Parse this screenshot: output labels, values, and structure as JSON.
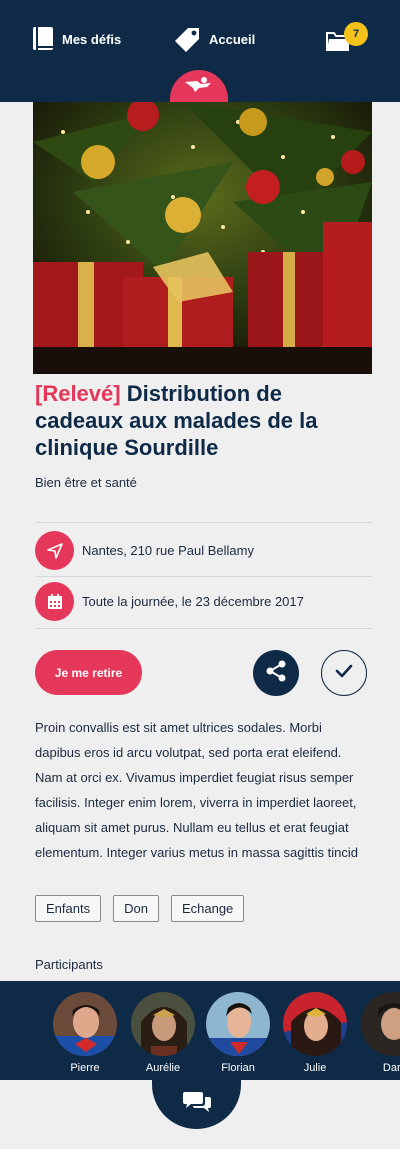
{
  "nav": {
    "defis_label": "Mes défis",
    "accueil_label": "Accueil",
    "folder_badge": "7"
  },
  "event": {
    "tag": "[Relevé]",
    "title": "Distribution de cadeaux aux malades de la clinique Sourdille",
    "category": "Bien être et santé",
    "location": "Nantes, 210 rue Paul Bellamy",
    "datetime": "Toute la journée, le 23 décembre 2017",
    "withdraw_label": "Je me retire",
    "description": "Proin convallis est sit amet ultrices sodales. Morbi dapibus eros id arcu volutpat, sed porta erat eleifend. Nam at orci ex. Vivamus imperdiet feugiat risus semper facilisis. Integer enim lorem, viverra in imperdiet laoreet, aliquam sit amet purus. Nullam eu tellus et erat feugiat elementum. Integer varius metus in massa sagittis tincid",
    "tags": [
      "Enfants",
      "Don",
      "Echange"
    ]
  },
  "participants": {
    "title": "Participants",
    "people": [
      "Pierre",
      "Aurélie",
      "Florian",
      "Julie",
      "Dari"
    ]
  },
  "colors": {
    "navy": "#0e2a47",
    "accent": "#e4375a",
    "badge": "#f4c21b"
  }
}
